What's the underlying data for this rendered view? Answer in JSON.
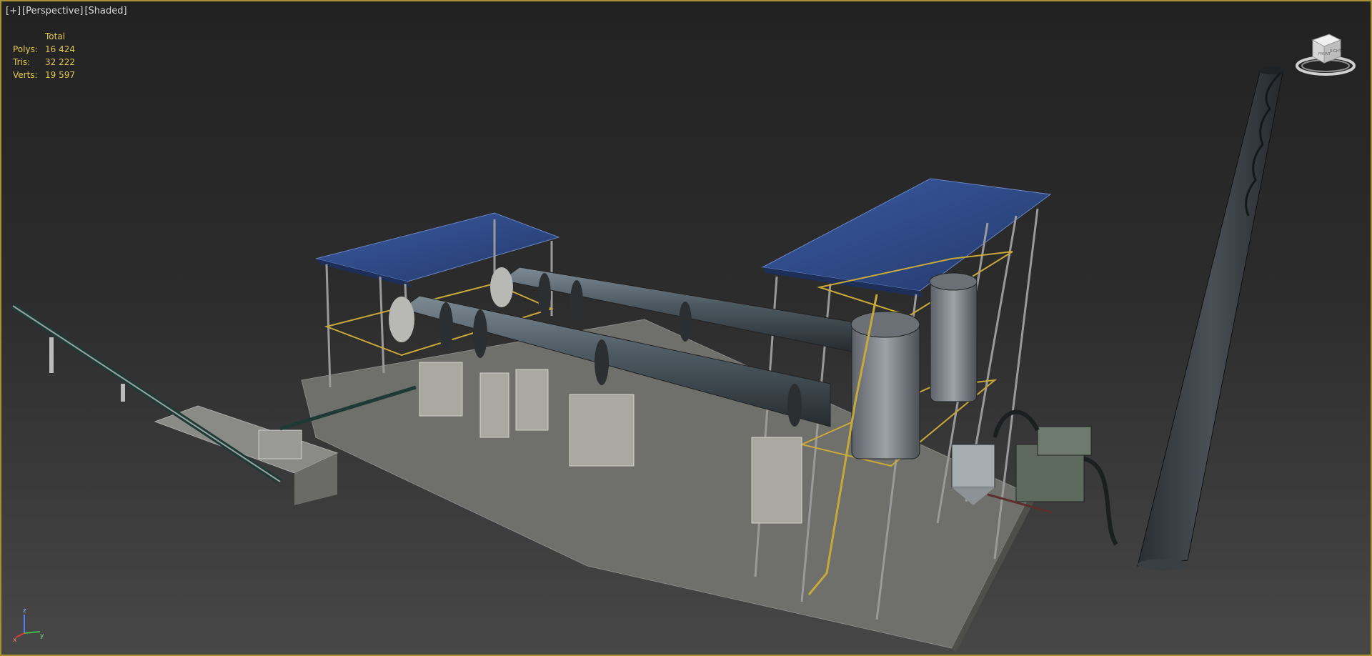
{
  "viewport": {
    "menu_plus": "[+]",
    "view_mode": "[Perspective]",
    "shading_mode": "[Shaded]"
  },
  "stats": {
    "header": "Total",
    "rows": [
      {
        "label": "Polys:",
        "value": "16 424"
      },
      {
        "label": "Tris:",
        "value": "32 222"
      },
      {
        "label": "Verts:",
        "value": "19 597"
      }
    ]
  },
  "viewcube": {
    "face_front": "FRONT",
    "face_right": "RIGHT",
    "face_top": "TOP"
  },
  "gizmo": {
    "axis_x": "x",
    "axis_y": "y",
    "axis_z": "z"
  },
  "colors": {
    "viewport_border": "#a8922e",
    "stats_text": "#e2c94e",
    "roof_blue": "#2d4a86",
    "handrail_yellow": "#c9a93a",
    "kiln_gray": "#55616a"
  },
  "scene": {
    "description_icon": "industrial-rotary-kiln-plant-model"
  }
}
